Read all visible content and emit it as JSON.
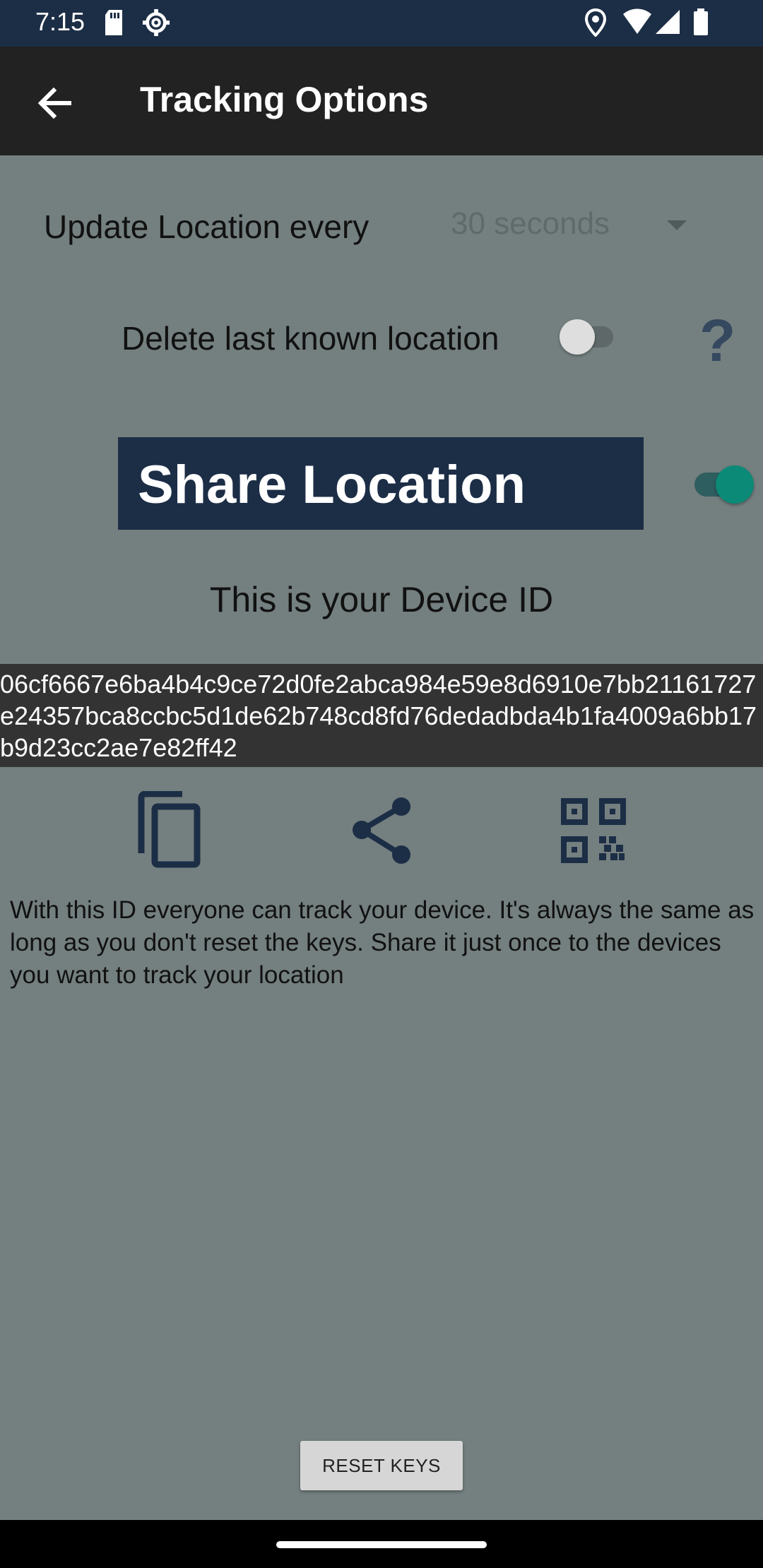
{
  "status_bar": {
    "time": "7:15",
    "icons": [
      "sd-card-icon",
      "settings-icon",
      "location-icon",
      "wifi-icon",
      "signal-icon",
      "battery-icon"
    ]
  },
  "app_bar": {
    "title": "Tracking Options"
  },
  "update": {
    "label": "Update Location every",
    "selected": "30 seconds"
  },
  "delete_last": {
    "label": "Delete last known location",
    "enabled": false,
    "help": "?"
  },
  "share": {
    "label": "Share Location",
    "enabled": true
  },
  "device": {
    "title": "This is your Device ID",
    "id": "06cf6667e6ba4b4c9ce72d0fe2abca984e59e8d6910e7bb21161727e24357bca8ccbc5d1de62b748cd8fd76dedadbda4b1fa4009a6bb17b9d23cc2ae7e82ff42"
  },
  "actions": [
    "copy-icon",
    "share-icon",
    "qr-code-icon"
  ],
  "note": "With this ID everyone can track your device. It's always the same as long as you don't reset the keys. Share it just once to the devices you want to track your location",
  "reset_button": "RESET KEYS",
  "colors": {
    "primary_dark": "#1c2e46",
    "accent": "#0b8a78",
    "background": "#747f7f",
    "app_bar": "#222222"
  }
}
